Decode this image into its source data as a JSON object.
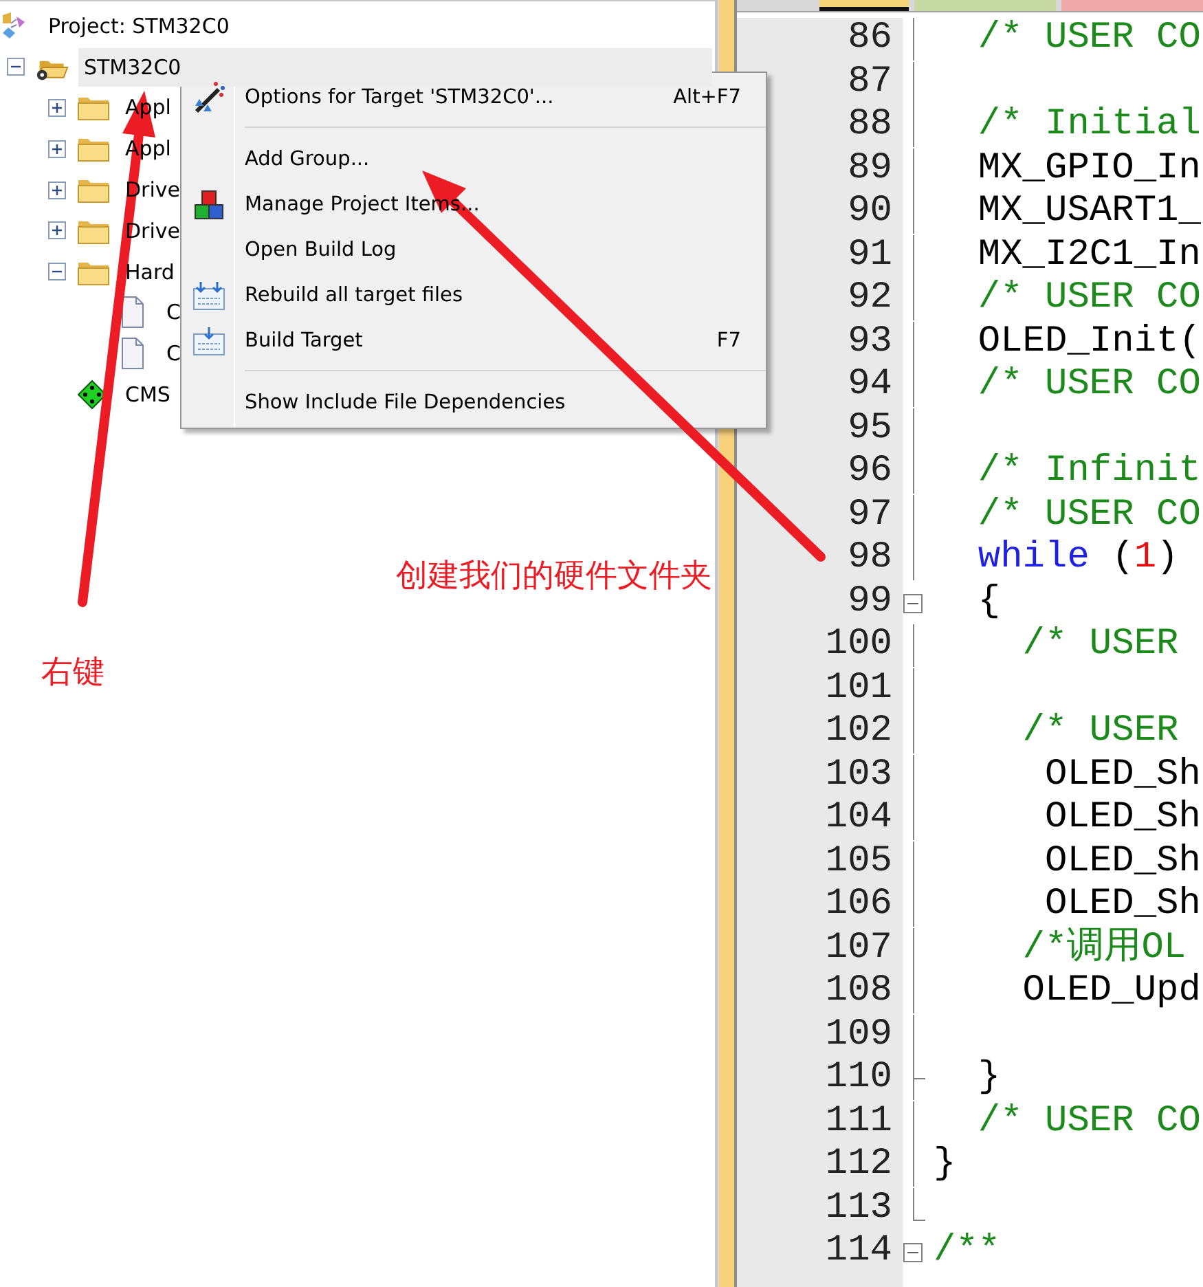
{
  "project_tree": {
    "label": "Project: STM32C0",
    "kind": "project",
    "selected": false,
    "children": [
      {
        "label": "STM32C0",
        "kind": "target",
        "selected": true,
        "expanded": true,
        "children": [
          {
            "label": "Appl",
            "kind": "folder",
            "selected": false,
            "expanded": false
          },
          {
            "label": "Appl",
            "kind": "folder",
            "selected": false,
            "expanded": false
          },
          {
            "label": "Drive",
            "kind": "folder",
            "selected": false,
            "expanded": false
          },
          {
            "label": "Drive",
            "kind": "folder",
            "selected": false,
            "expanded": false
          },
          {
            "label": "Hard",
            "kind": "folder",
            "selected": false,
            "expanded": true,
            "children": [
              {
                "label": "C",
                "kind": "file",
                "selected": false
              },
              {
                "label": "C",
                "kind": "file",
                "selected": false
              }
            ]
          },
          {
            "label": "CMS",
            "kind": "pack",
            "selected": false
          }
        ]
      }
    ]
  },
  "context_menu": [
    {
      "kind": "item",
      "label": "Options for Target 'STM32C0'...",
      "shortcut": "Alt+F7"
    },
    {
      "kind": "separator"
    },
    {
      "kind": "item",
      "label": "Add Group..."
    },
    {
      "kind": "item",
      "label": "Manage Project Items..."
    },
    {
      "kind": "item",
      "label": "Open Build Log"
    },
    {
      "kind": "item",
      "label": "Rebuild all target files"
    },
    {
      "kind": "item",
      "label": "Build Target",
      "shortcut": "F7"
    },
    {
      "kind": "separator"
    },
    {
      "kind": "item",
      "label": "Show Include File Dependencies"
    }
  ],
  "editor_tabs": [
    {
      "selected": true,
      "color": "#f6d57a"
    },
    {
      "selected": false,
      "color": "#c7d9a3"
    },
    {
      "selected": false,
      "color": "#f0a9a9"
    }
  ],
  "editor_lines": [
    {
      "number": "86",
      "fold": {
        "kind": "line"
      },
      "segments": [
        {
          "kind": "comment",
          "text": "  /* USER CO"
        }
      ]
    },
    {
      "number": "87",
      "fold": {
        "kind": "line"
      }
    },
    {
      "number": "88",
      "fold": {
        "kind": "line"
      },
      "segments": [
        {
          "kind": "comment",
          "text": "  /* Initial"
        }
      ]
    },
    {
      "number": "89",
      "fold": {
        "kind": "line"
      },
      "segments": [
        {
          "kind": "code",
          "text": "  MX_GPIO_In"
        }
      ]
    },
    {
      "number": "90",
      "fold": {
        "kind": "line"
      },
      "segments": [
        {
          "kind": "code",
          "text": "  MX_USART1_"
        }
      ]
    },
    {
      "number": "91",
      "fold": {
        "kind": "line"
      },
      "segments": [
        {
          "kind": "code",
          "text": "  MX_I2C1_In"
        }
      ]
    },
    {
      "number": "92",
      "fold": {
        "kind": "line"
      },
      "segments": [
        {
          "kind": "comment",
          "text": "  /* USER CO"
        }
      ]
    },
    {
      "number": "93",
      "fold": {
        "kind": "line"
      },
      "segments": [
        {
          "kind": "code",
          "text": "  OLED_Init("
        }
      ]
    },
    {
      "number": "94",
      "fold": {
        "kind": "line"
      },
      "segments": [
        {
          "kind": "comment",
          "text": "  /* USER CO"
        }
      ]
    },
    {
      "number": "95",
      "fold": {
        "kind": "line"
      }
    },
    {
      "number": "96",
      "fold": {
        "kind": "line"
      },
      "segments": [
        {
          "kind": "comment",
          "text": "  /* Infinit"
        }
      ]
    },
    {
      "number": "97",
      "fold": {
        "kind": "line"
      },
      "segments": [
        {
          "kind": "comment",
          "text": "  /* USER CO"
        }
      ]
    },
    {
      "number": "98",
      "fold": {
        "kind": "line"
      },
      "segments": [
        {
          "kind": "keyword",
          "text": "  while"
        },
        {
          "kind": "code",
          "text": " ("
        },
        {
          "kind": "number",
          "text": "1"
        },
        {
          "kind": "code",
          "text": ")"
        }
      ]
    },
    {
      "number": "99",
      "fold": {
        "kind": "start"
      },
      "segments": [
        {
          "kind": "code",
          "text": "  {"
        }
      ]
    },
    {
      "number": "100",
      "fold": {
        "kind": "line"
      },
      "segments": [
        {
          "kind": "comment",
          "text": "    /* USER"
        }
      ]
    },
    {
      "number": "101",
      "fold": {
        "kind": "line"
      }
    },
    {
      "number": "102",
      "fold": {
        "kind": "line"
      },
      "segments": [
        {
          "kind": "comment",
          "text": "    /* USER"
        }
      ]
    },
    {
      "number": "103",
      "fold": {
        "kind": "line"
      },
      "segments": [
        {
          "kind": "code",
          "text": "     OLED_Sh"
        }
      ]
    },
    {
      "number": "104",
      "fold": {
        "kind": "line"
      },
      "segments": [
        {
          "kind": "code",
          "text": "     OLED_Sh"
        }
      ]
    },
    {
      "number": "105",
      "fold": {
        "kind": "line"
      },
      "segments": [
        {
          "kind": "code",
          "text": "     OLED_Sh"
        }
      ]
    },
    {
      "number": "106",
      "fold": {
        "kind": "line"
      },
      "segments": [
        {
          "kind": "code",
          "text": "     OLED_Sh"
        }
      ]
    },
    {
      "number": "107",
      "fold": {
        "kind": "line"
      },
      "segments": [
        {
          "kind": "comment",
          "text": "    /*调用OL"
        }
      ]
    },
    {
      "number": "108",
      "fold": {
        "kind": "line"
      },
      "segments": [
        {
          "kind": "code",
          "text": "    OLED_Upd"
        }
      ]
    },
    {
      "number": "109",
      "fold": {
        "kind": "line"
      }
    },
    {
      "number": "110",
      "fold": {
        "kind": "branch"
      },
      "segments": [
        {
          "kind": "code",
          "text": "  }"
        }
      ]
    },
    {
      "number": "111",
      "fold": {
        "kind": "line"
      },
      "segments": [
        {
          "kind": "comment",
          "text": "  /* USER CO"
        }
      ]
    },
    {
      "number": "112",
      "fold": {
        "kind": "line"
      },
      "segments": [
        {
          "kind": "code",
          "text": "}"
        }
      ]
    },
    {
      "number": "113",
      "fold": {
        "kind": "end"
      }
    },
    {
      "number": "114",
      "fold": {
        "kind": "start"
      },
      "segments": [
        {
          "kind": "comment",
          "text": "/**"
        }
      ]
    }
  ],
  "annotations": [
    {
      "text": "右键"
    },
    {
      "text": "创建我们的硬件文件夹"
    }
  ]
}
